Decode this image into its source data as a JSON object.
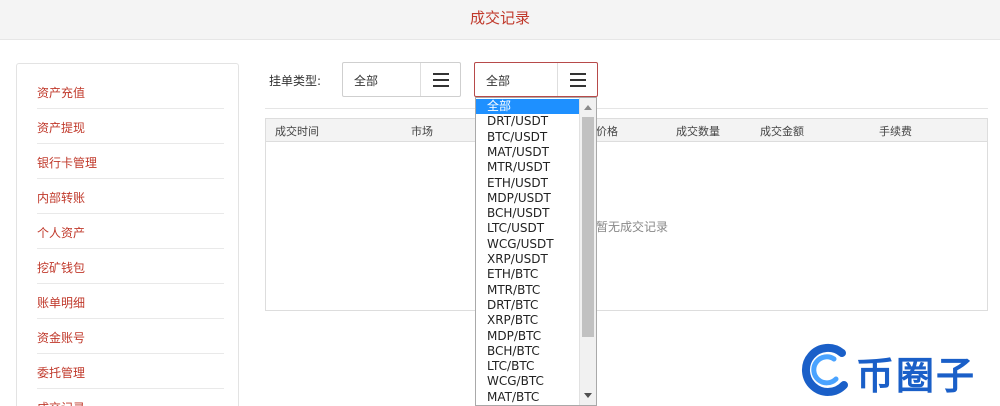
{
  "page": {
    "title": "成交记录"
  },
  "sidebar": {
    "items": [
      {
        "label": "资产充值"
      },
      {
        "label": "资产提现"
      },
      {
        "label": "银行卡管理"
      },
      {
        "label": "内部转账"
      },
      {
        "label": "个人资产"
      },
      {
        "label": "挖矿钱包"
      },
      {
        "label": "账单明细"
      },
      {
        "label": "资金账号"
      },
      {
        "label": "委托管理"
      },
      {
        "label": "成交记录"
      }
    ]
  },
  "filters": {
    "type_label": "挂单类型:",
    "type_select": {
      "value": "全部"
    },
    "market_select": {
      "value": "全部"
    }
  },
  "table": {
    "columns": [
      "成交时间",
      "市场",
      "价格",
      "成交数量",
      "成交金额",
      "手续费"
    ],
    "empty_text": "暂无成交记录"
  },
  "dropdown": {
    "options": [
      "全部",
      "DRT/USDT",
      "BTC/USDT",
      "MAT/USDT",
      "MTR/USDT",
      "ETH/USDT",
      "MDP/USDT",
      "BCH/USDT",
      "LTC/USDT",
      "WCG/USDT",
      "XRP/USDT",
      "ETH/BTC",
      "MTR/BTC",
      "DRT/BTC",
      "XRP/BTC",
      "MDP/BTC",
      "BCH/BTC",
      "LTC/BTC",
      "WCG/BTC",
      "MAT/BTC"
    ],
    "selected_index": 0
  },
  "watermark": {
    "text": "币圈子"
  },
  "colors": {
    "accent": "#c0392b",
    "selected": "#1e90ff",
    "watermark": "#1a5fc8"
  }
}
